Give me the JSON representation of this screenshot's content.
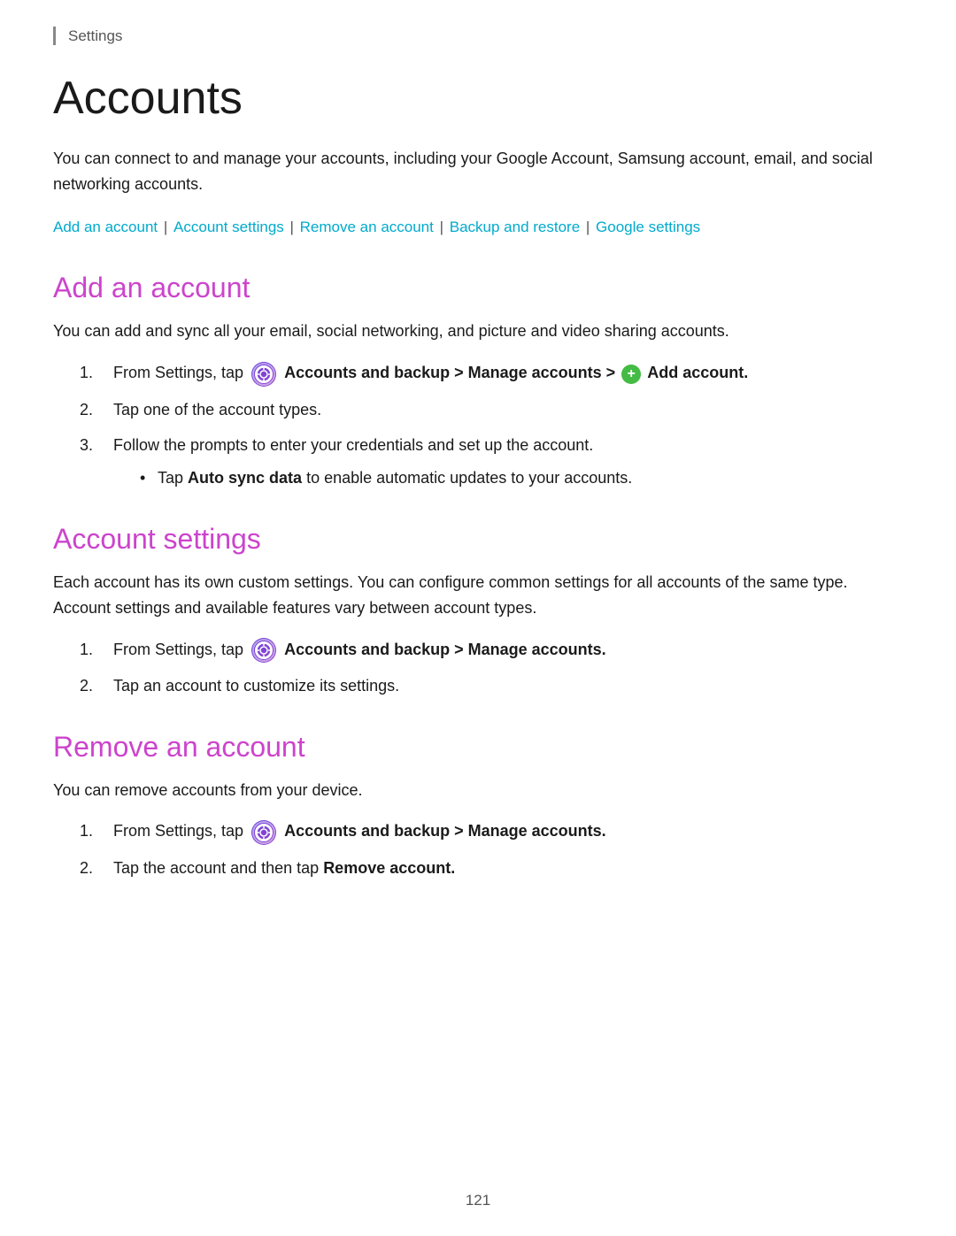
{
  "breadcrumb": {
    "label": "Settings"
  },
  "page": {
    "title": "Accounts",
    "intro": "You can connect to and manage your accounts, including your Google Account, Samsung account, email, and social networking accounts.",
    "nav_links": [
      {
        "label": "Add an account",
        "id": "add-account-link"
      },
      {
        "label": "Account settings",
        "id": "account-settings-link"
      },
      {
        "label": "Remove an account",
        "id": "remove-account-link"
      },
      {
        "label": "Backup and restore",
        "id": "backup-restore-link"
      },
      {
        "label": "Google settings",
        "id": "google-settings-link"
      }
    ]
  },
  "sections": [
    {
      "id": "add-an-account",
      "title": "Add an account",
      "intro": "You can add and sync all your email, social networking, and picture and video sharing accounts.",
      "steps": [
        {
          "text_parts": [
            {
              "type": "text",
              "content": "From Settings, tap "
            },
            {
              "type": "icon",
              "name": "settings-icon"
            },
            {
              "type": "bold",
              "content": "Accounts and backup > Manage accounts > "
            },
            {
              "type": "plus-icon"
            },
            {
              "type": "bold",
              "content": "Add account."
            }
          ]
        },
        {
          "text": "Tap one of the account types."
        },
        {
          "text": "Follow the prompts to enter your credentials and set up the account.",
          "bullet": "Tap Auto sync data to enable automatic updates to your accounts."
        }
      ]
    },
    {
      "id": "account-settings",
      "title": "Account settings",
      "intro": "Each account has its own custom settings. You can configure common settings for all accounts of the same type. Account settings and available features vary between account types.",
      "steps": [
        {
          "text_parts": [
            {
              "type": "text",
              "content": "From Settings, tap "
            },
            {
              "type": "icon",
              "name": "settings-icon"
            },
            {
              "type": "bold",
              "content": "Accounts and backup > Manage accounts."
            }
          ]
        },
        {
          "text": "Tap an account to customize its settings."
        }
      ]
    },
    {
      "id": "remove-an-account",
      "title": "Remove an account",
      "intro": "You can remove accounts from your device.",
      "steps": [
        {
          "text_parts": [
            {
              "type": "text",
              "content": "From Settings, tap "
            },
            {
              "type": "icon",
              "name": "settings-icon"
            },
            {
              "type": "bold",
              "content": "Accounts and backup > Manage accounts."
            }
          ]
        },
        {
          "text": "Tap the account and then tap ",
          "bold_suffix": "Remove account."
        }
      ]
    }
  ],
  "page_number": "121"
}
